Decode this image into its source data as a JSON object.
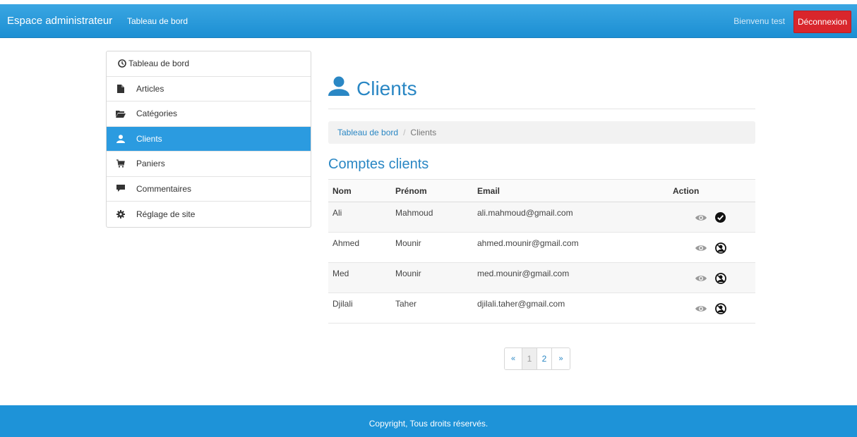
{
  "navbar": {
    "brand": "Espace administrateur",
    "link": "Tableau de bord",
    "welcome": "Bienvenu test",
    "logout": "Déconnexion"
  },
  "sidebar": {
    "items": [
      {
        "label": "Tableau de bord",
        "icon": "dashboard-icon",
        "active": false
      },
      {
        "label": "Articles",
        "icon": "file-icon",
        "active": false
      },
      {
        "label": "Catégories",
        "icon": "folder-open-icon",
        "active": false
      },
      {
        "label": "Clients",
        "icon": "user-icon",
        "active": true
      },
      {
        "label": "Paniers",
        "icon": "cart-icon",
        "active": false
      },
      {
        "label": "Commentaires",
        "icon": "comment-icon",
        "active": false
      },
      {
        "label": "Réglage de site",
        "icon": "cog-icon",
        "active": false
      }
    ]
  },
  "main": {
    "title": "Clients",
    "breadcrumb": {
      "link": "Tableau de bord",
      "separator": "/",
      "current": "Clients"
    },
    "section_title": "Comptes clients",
    "table": {
      "headers": [
        "Nom",
        "Prénom",
        "Email",
        "Action"
      ],
      "rows": [
        {
          "nom": "Ali",
          "prenom": "Mahmoud",
          "email": "ali.mahmoud@gmail.com",
          "status_icon": "check-circle-icon"
        },
        {
          "nom": "Ahmed",
          "prenom": "Mounir",
          "email": "ahmed.mounir@gmail.com",
          "status_icon": "user-ban-icon"
        },
        {
          "nom": "Med",
          "prenom": "Mounir",
          "email": "med.mounir@gmail.com",
          "status_icon": "user-ban-icon"
        },
        {
          "nom": "Djilali",
          "prenom": "Taher",
          "email": "djilali.taher@gmail.com",
          "status_icon": "user-ban-icon"
        }
      ]
    },
    "pagination": {
      "prev": "«",
      "pages": [
        "1",
        "2"
      ],
      "next": "»",
      "current": "1"
    }
  },
  "footer": {
    "text": "Copyright, Tous droits réservés."
  },
  "colors": {
    "primary": "#1e93d8",
    "danger": "#d9262c",
    "title": "#2a87c4"
  }
}
